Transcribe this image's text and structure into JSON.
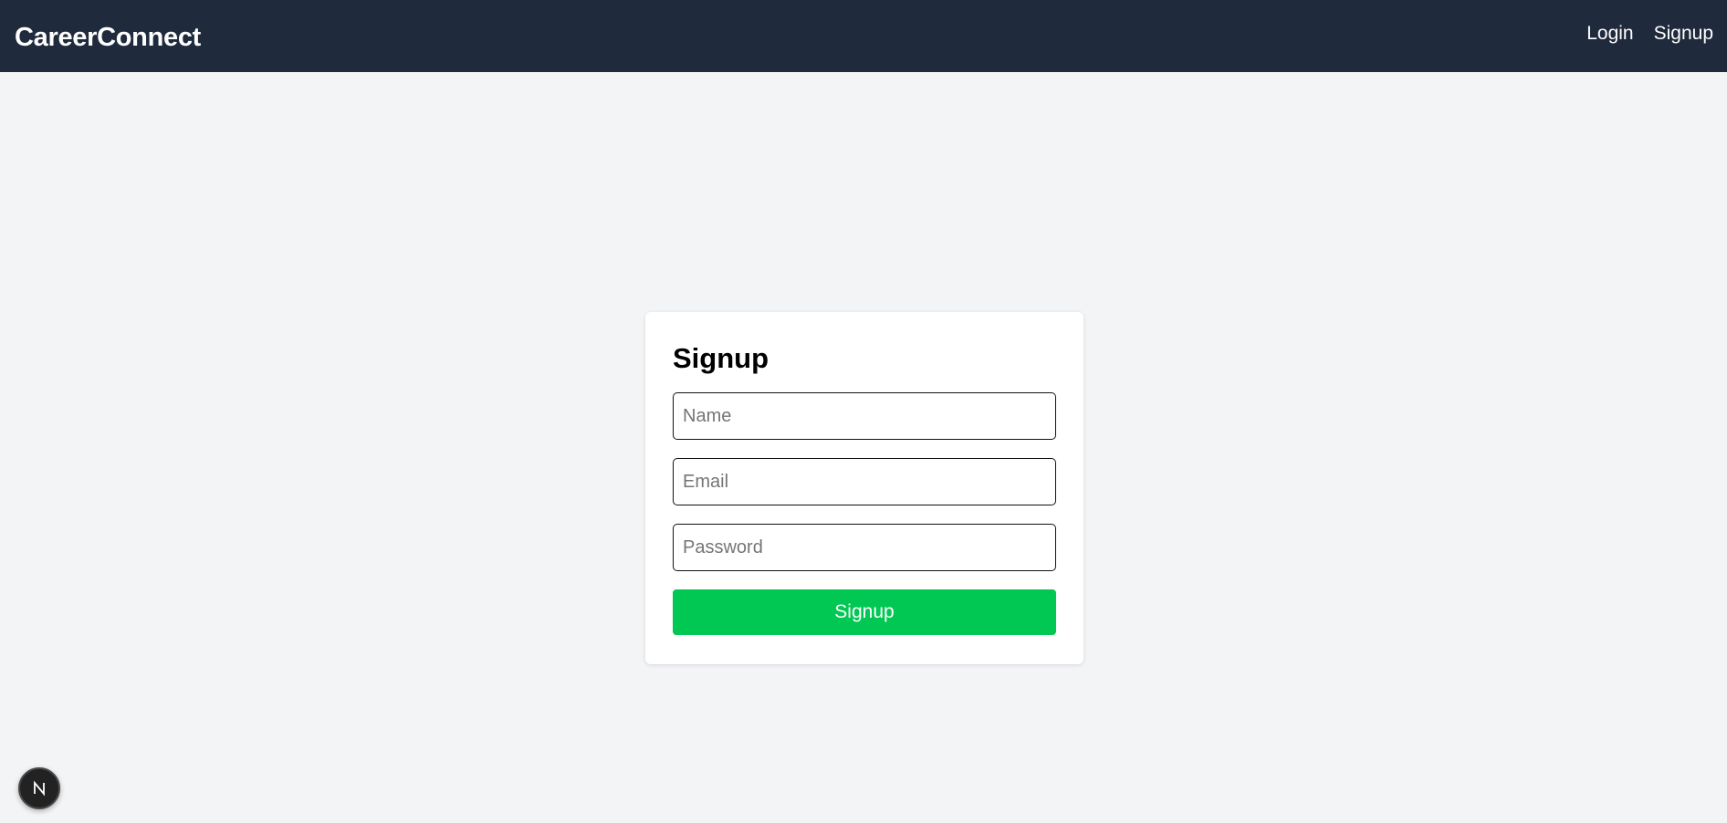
{
  "navbar": {
    "brand": "CareerConnect",
    "links": [
      {
        "label": "Login"
      },
      {
        "label": "Signup"
      }
    ]
  },
  "form": {
    "title": "Signup",
    "name_placeholder": "Name",
    "email_placeholder": "Email",
    "password_placeholder": "Password",
    "submit_label": "Signup"
  },
  "badge": {
    "icon": "nextjs-logo-icon"
  },
  "colors": {
    "navbar_bg": "#1f2a3c",
    "page_bg": "#f3f4f6",
    "submit_bg": "#00c853"
  }
}
